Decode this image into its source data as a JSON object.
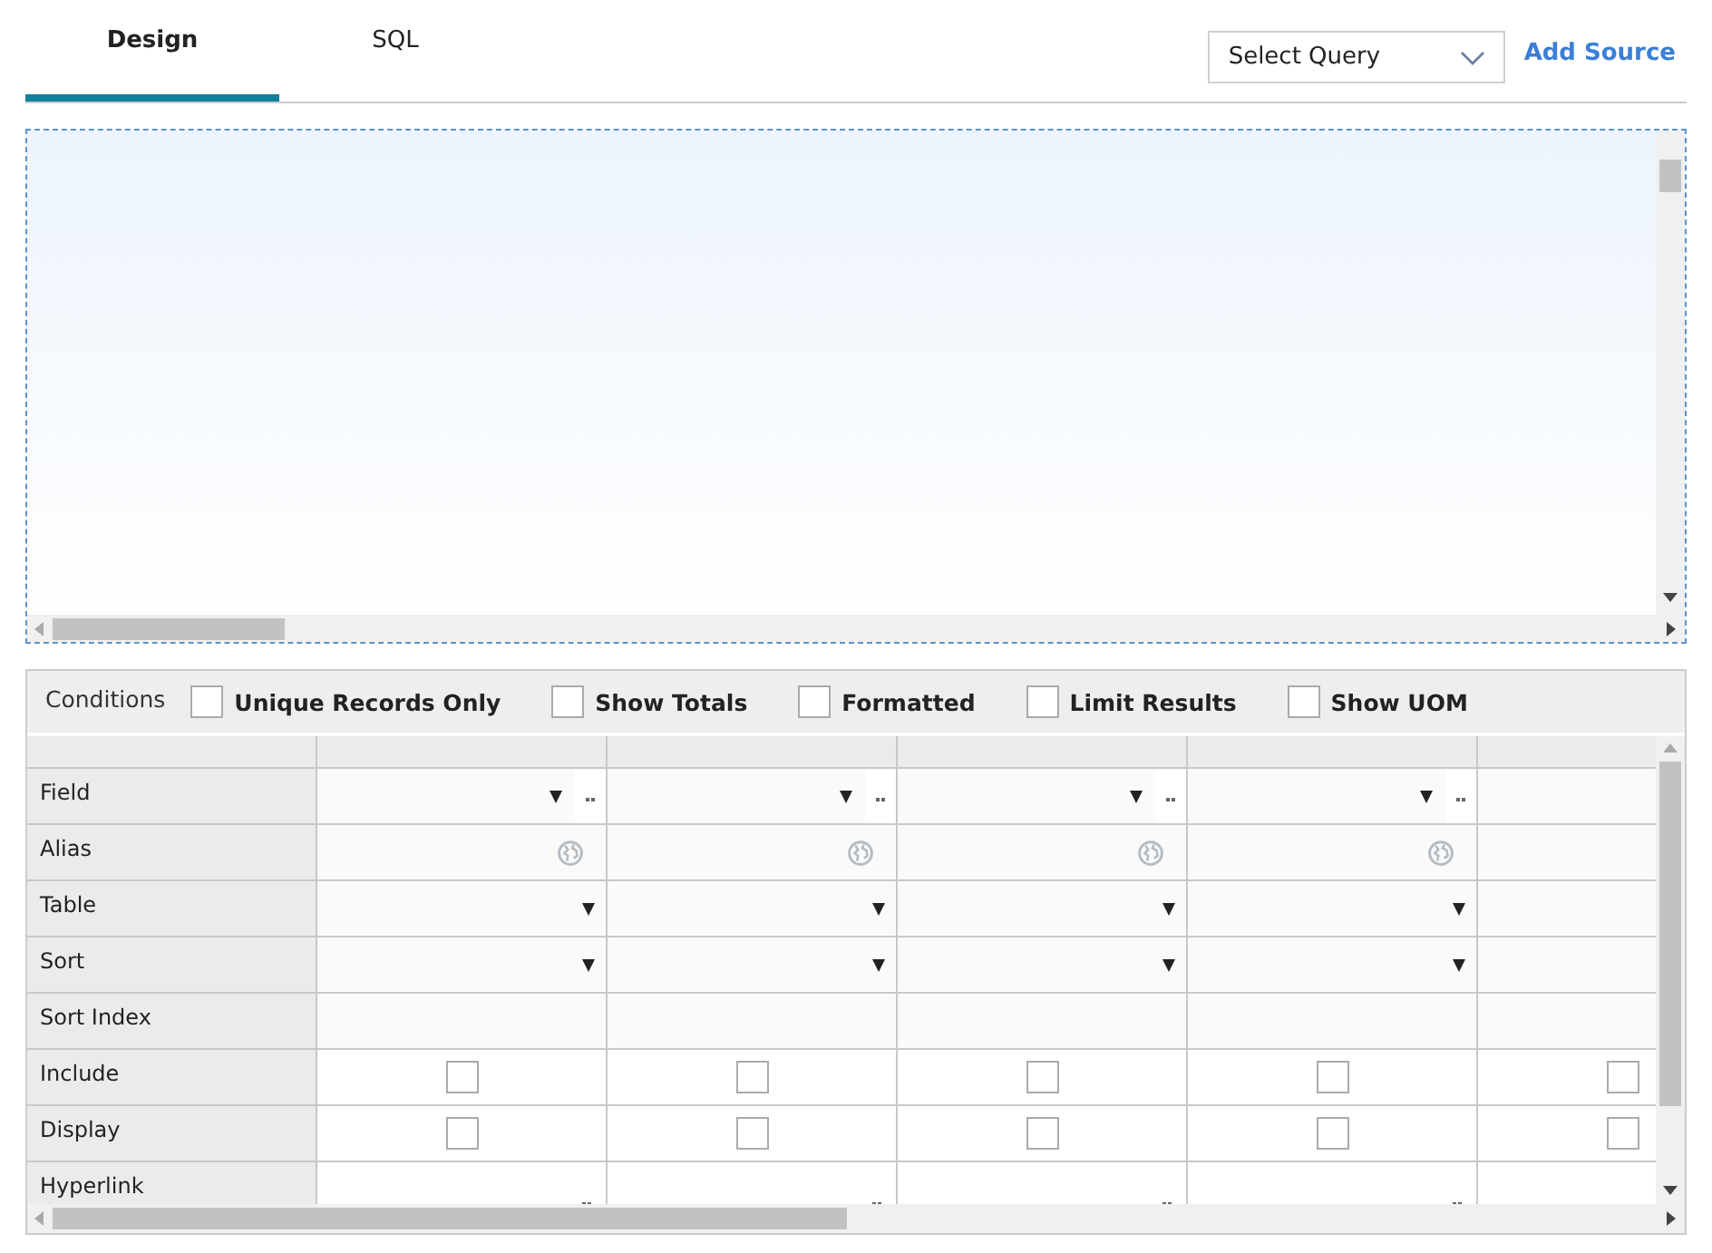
{
  "tabs": [
    {
      "label": "Design",
      "selected": true
    },
    {
      "label": "SQL",
      "selected": false
    }
  ],
  "query_select": {
    "placeholder": "Select Query"
  },
  "add_source": "Add Source",
  "conditions": {
    "label": "Conditions",
    "options": [
      {
        "label": "Unique Records Only",
        "checked": false
      },
      {
        "label": "Show Totals",
        "checked": false
      },
      {
        "label": "Formatted",
        "checked": false
      },
      {
        "label": "Limit Results",
        "checked": false
      },
      {
        "label": "Show UOM",
        "checked": false
      }
    ]
  },
  "grid": {
    "rows": [
      {
        "label": "Field",
        "kind": "field"
      },
      {
        "label": "Alias",
        "kind": "alias"
      },
      {
        "label": "Table",
        "kind": "dropdown"
      },
      {
        "label": "Sort",
        "kind": "dropdown"
      },
      {
        "label": "Sort Index",
        "kind": "text"
      },
      {
        "label": "Include",
        "kind": "checkbox",
        "cells": [
          {
            "checked": false
          },
          {
            "checked": false
          },
          {
            "checked": false
          },
          {
            "checked": false
          },
          {
            "checked": false
          }
        ]
      },
      {
        "label": "Display",
        "kind": "checkbox",
        "cells": [
          {
            "checked": false
          },
          {
            "checked": false
          },
          {
            "checked": false
          },
          {
            "checked": false
          },
          {
            "checked": false
          }
        ]
      },
      {
        "label": "Hyperlink",
        "kind": "ellipsis"
      }
    ]
  }
}
